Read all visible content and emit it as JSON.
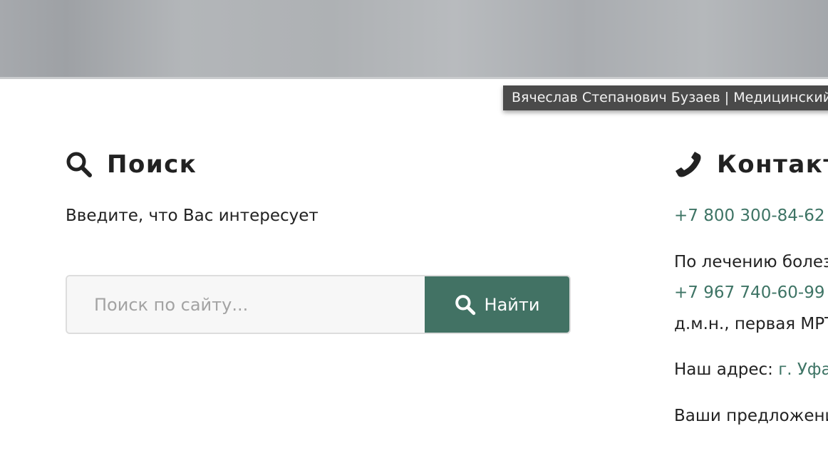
{
  "tooltip": "Вячеслав Степанович Бузаев | Медицинский",
  "search": {
    "title": "Поиск",
    "hint": "Введите, что Вас интересует",
    "placeholder": "Поиск по сайту...",
    "button_label": "Найти",
    "icon": "search-icon"
  },
  "contacts": {
    "title": "Контакты",
    "icon": "phone-icon",
    "phone1": "+7 800 300-84-62",
    "treatment_label": "По лечению болезней",
    "phone2": "+7 967 740-60-99",
    "doctor_line": "д.м.н., первая МРТ",
    "address_label": "Наш адрес:",
    "address_value": "г. Уфа",
    "suggestions": "Ваши предложения"
  },
  "colors": {
    "accent": "#427264",
    "link": "#3e7465"
  }
}
